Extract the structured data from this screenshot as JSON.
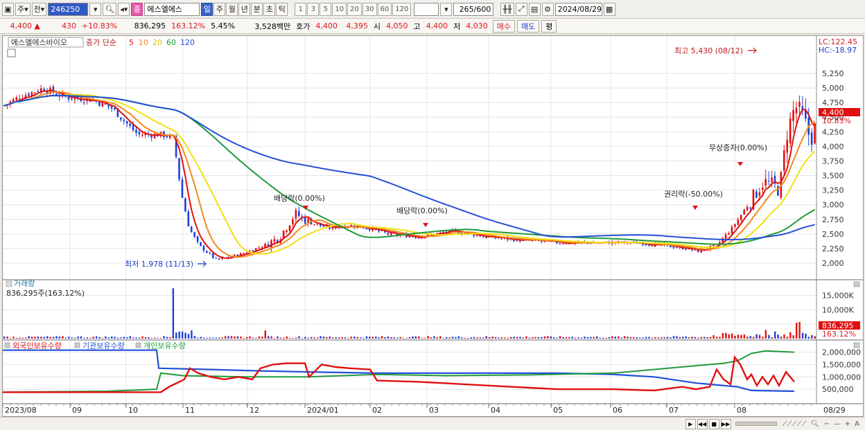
{
  "toolbar": {
    "market": "주",
    "adj": "전",
    "code": "246250",
    "name": "에스엘에스",
    "periods": [
      "일",
      "주",
      "월",
      "년",
      "분",
      "초",
      "틱"
    ],
    "active_period": "일",
    "intervals": [
      "1",
      "3",
      "5",
      "10",
      "20",
      "30",
      "60",
      "120"
    ],
    "count": "265",
    "max": "/600",
    "date": "2024/08/29"
  },
  "quote": {
    "price": "4,400",
    "change": "430",
    "change_rate": "+10.83%",
    "volume": "836,295",
    "vol_ratio": "163.12%",
    "turnover": "5.45%",
    "amount": "3,528백만",
    "ask_label": "호가",
    "ask": "4,400",
    "bid": "4,395",
    "open_label": "시",
    "open": "4,050",
    "high_label": "고",
    "high": "4,400",
    "low_label": "저",
    "low": "4,030",
    "buy_label": "매수",
    "sell_label": "매도",
    "avg_label": "평"
  },
  "price_panel": {
    "stock_label": "에스엘에스바이오",
    "ma_label": "종가 단순",
    "ma_periods": [
      "5",
      "10",
      "20",
      "60",
      "120"
    ],
    "ma_colors": [
      "#e01010",
      "#f08a1c",
      "#f0e010",
      "#1e9a3c",
      "#2250d8"
    ],
    "lc": "LC:122.45",
    "hc": "HC:-18.97",
    "price_tag": "4,400",
    "rate_tag": "10.83%",
    "high_note": "최고 5,430 (08/12)",
    "low_note": "최저 1,978 (11/13)",
    "events": [
      "배당락(0.00%)",
      "배당락(0.00%)",
      "권리락(-50.00%)",
      "무상증자(0.00%)"
    ],
    "y_ticks": [
      "5,250",
      "5,000",
      "4,750",
      "4,500",
      "4,250",
      "4,000",
      "3,750",
      "3,500",
      "3,250",
      "3,000",
      "2,750",
      "2,500",
      "2,250",
      "2,000"
    ]
  },
  "volume_panel": {
    "title": "거래량",
    "value": "836,295주(163.12%)",
    "ticks": [
      "15,000K",
      "10,000K",
      "5,000K"
    ],
    "tag": "836,295",
    "tag2": "163.12%"
  },
  "holding_panel": {
    "series": [
      {
        "name": "외국인보유수량",
        "color": "#e01010"
      },
      {
        "name": "기관보유수량",
        "color": "#2250d8"
      },
      {
        "name": "개인보유수량",
        "color": "#1e9a3c"
      }
    ],
    "ticks": [
      "2,000,000",
      "1,500,000",
      "1,000,000",
      "500,000"
    ]
  },
  "x_axis": [
    "2023/08",
    "09",
    "10",
    "11",
    "12",
    "2024/01",
    "02",
    "03",
    "04",
    "05",
    "06",
    "07",
    "08"
  ],
  "x_end": "08/29"
}
